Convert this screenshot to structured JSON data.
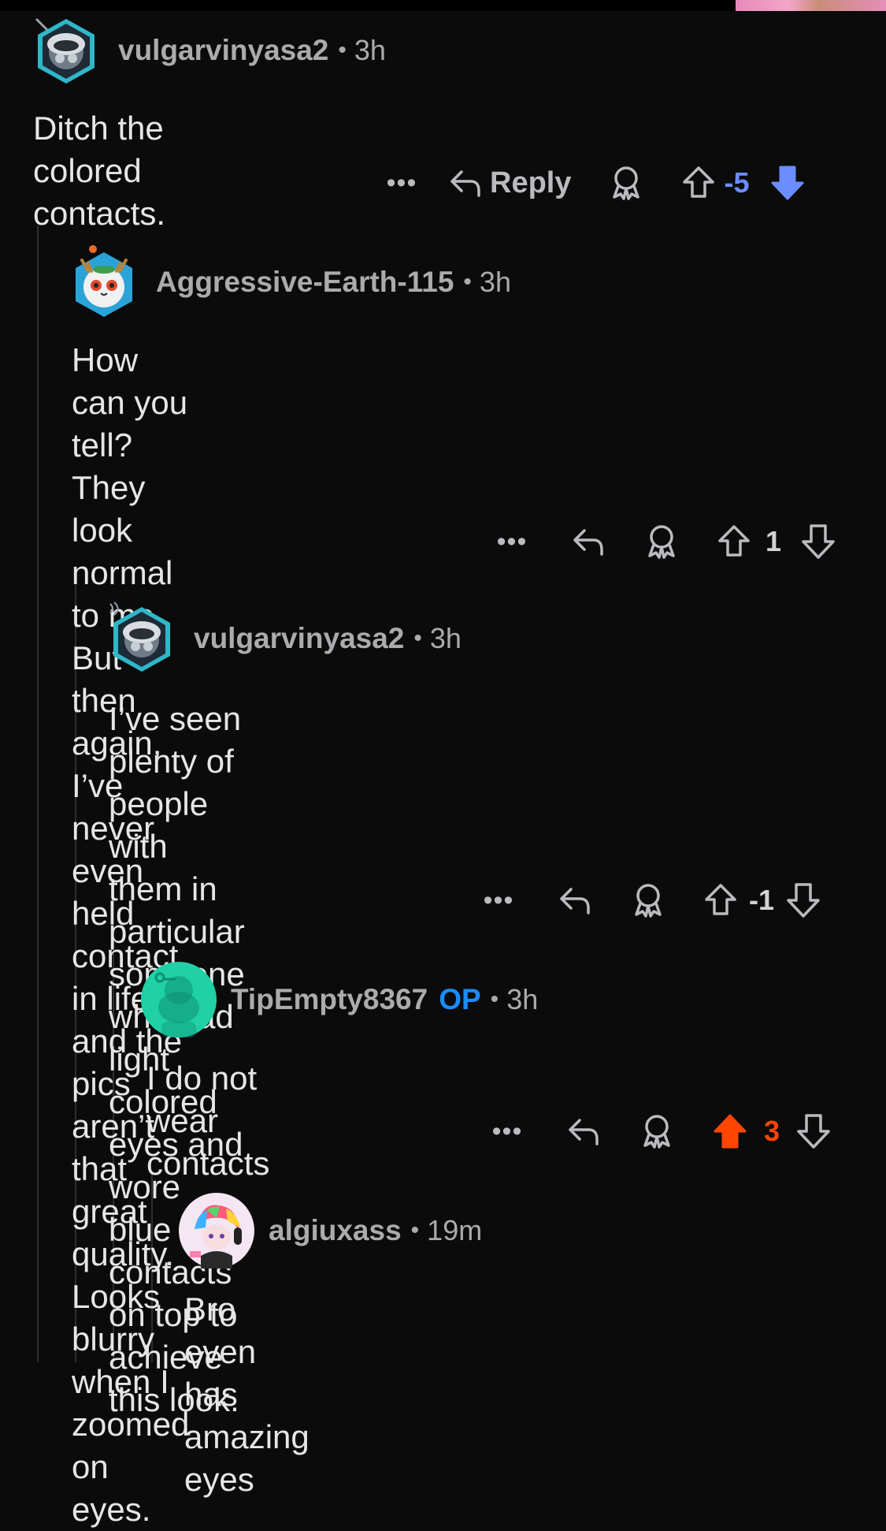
{
  "comments": [
    {
      "username": "vulgarvinyasa2",
      "time": "3h",
      "body": "Ditch the colored contacts.",
      "reply_label": "Reply",
      "score": "-5",
      "vote": "down"
    },
    {
      "username": "Aggressive-Earth-115",
      "time": "3h",
      "body": "How can you tell? They look normal to me. But\nthen again, I’ve never even held contact in life..\nand the pics aren’t that great quality. Looks\nblurry when I zoomed on eyes.",
      "score": "1",
      "vote": "none"
    },
    {
      "username": "vulgarvinyasa2",
      "time": "3h",
      "body": "I’ve seen plenty of people with them in\nparticular someone who had light colored\neyes and wore blue contacts on top to\nachieve this look.",
      "score": "-1",
      "vote": "none"
    },
    {
      "username": "TipEmpty8367",
      "op_badge": "OP",
      "time": "3h",
      "body": "I do not wear contacts",
      "score": "3",
      "vote": "up"
    },
    {
      "username": "algiuxass",
      "time": "19m",
      "body": "Bro even has amazing eyes"
    }
  ],
  "colors": {
    "background": "#0b0b0c",
    "downvote_active": "#6a8dff",
    "upvote_active": "#ff4500",
    "op_badge": "#1a8cff",
    "text_secondary": "#a9abad"
  },
  "icons": {
    "more": "more-horizontal-icon",
    "reply": "reply-arrow-icon",
    "award": "award-icon",
    "upvote": "upvote-arrow-icon",
    "downvote": "downvote-arrow-icon"
  },
  "ui": {
    "more_glyph": "•••",
    "separator": "•"
  }
}
